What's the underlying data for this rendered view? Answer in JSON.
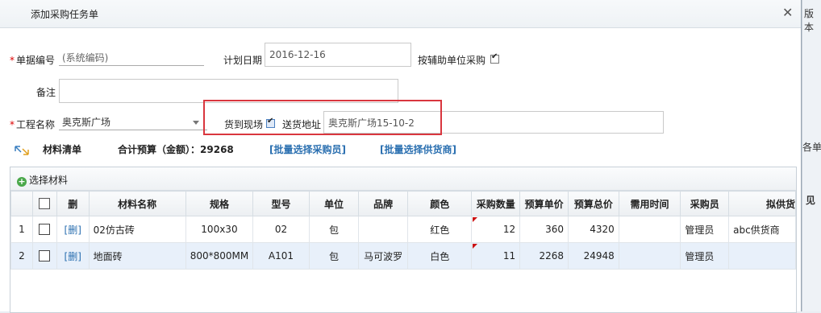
{
  "dialog": {
    "title": "添加采购任务单",
    "close_glyph": "✕"
  },
  "background_fragments": {
    "top_right": "版本",
    "mid_right_1": "各单",
    "mid_right_2": "见"
  },
  "form": {
    "doc_no_label": "单据编号",
    "doc_no_value": "(系统编码)",
    "plan_date_label": "计划日期",
    "plan_date_value": "2016-12-16",
    "aux_unit_label": "按辅助单位采购",
    "aux_unit_checked": true,
    "remark_label": "备注",
    "remark_value": "",
    "project_label": "工程名称",
    "project_value": "奥克斯广场",
    "onsite_label": "货到现场",
    "onsite_checked": true,
    "address_label": "送货地址",
    "address_value": "奥克斯广场15-10-2"
  },
  "materials": {
    "title": "材料清单",
    "budget_label": "合计预算（金额）：",
    "budget_value": "29268",
    "batch_buyer": "[批量选择采购员]",
    "batch_supplier": "[批量选择供货商]",
    "add_label": "选择材料"
  },
  "grid": {
    "headers": [
      "",
      "",
      "删",
      "材料名称",
      "规格",
      "型号",
      "单位",
      "品牌",
      "颜色",
      "采购数量",
      "预算单价",
      "预算总价",
      "需用时间",
      "采购员",
      "拟供货"
    ],
    "rows": [
      {
        "no": "1",
        "del": "[删]",
        "name": "02仿古砖",
        "spec": "100x30",
        "model": "02",
        "unit": "包",
        "brand": "",
        "color": "红色",
        "qty": "12",
        "price": "360",
        "total": "4320",
        "time": "",
        "buyer": "管理员",
        "supplier": "abc供货商"
      },
      {
        "no": "2",
        "del": "[删]",
        "name": "地面砖",
        "spec": "800*800MM",
        "model": "A101",
        "unit": "包",
        "brand": "马可波罗",
        "color": "白色",
        "qty": "11",
        "price": "2268",
        "total": "24948",
        "time": "",
        "buyer": "管理员",
        "supplier": ""
      }
    ]
  },
  "colors": {
    "link": "#2a6fb0",
    "highlight_box": "#d9363e",
    "alt_row": "#e8f0fa",
    "required": "#dd0000"
  }
}
